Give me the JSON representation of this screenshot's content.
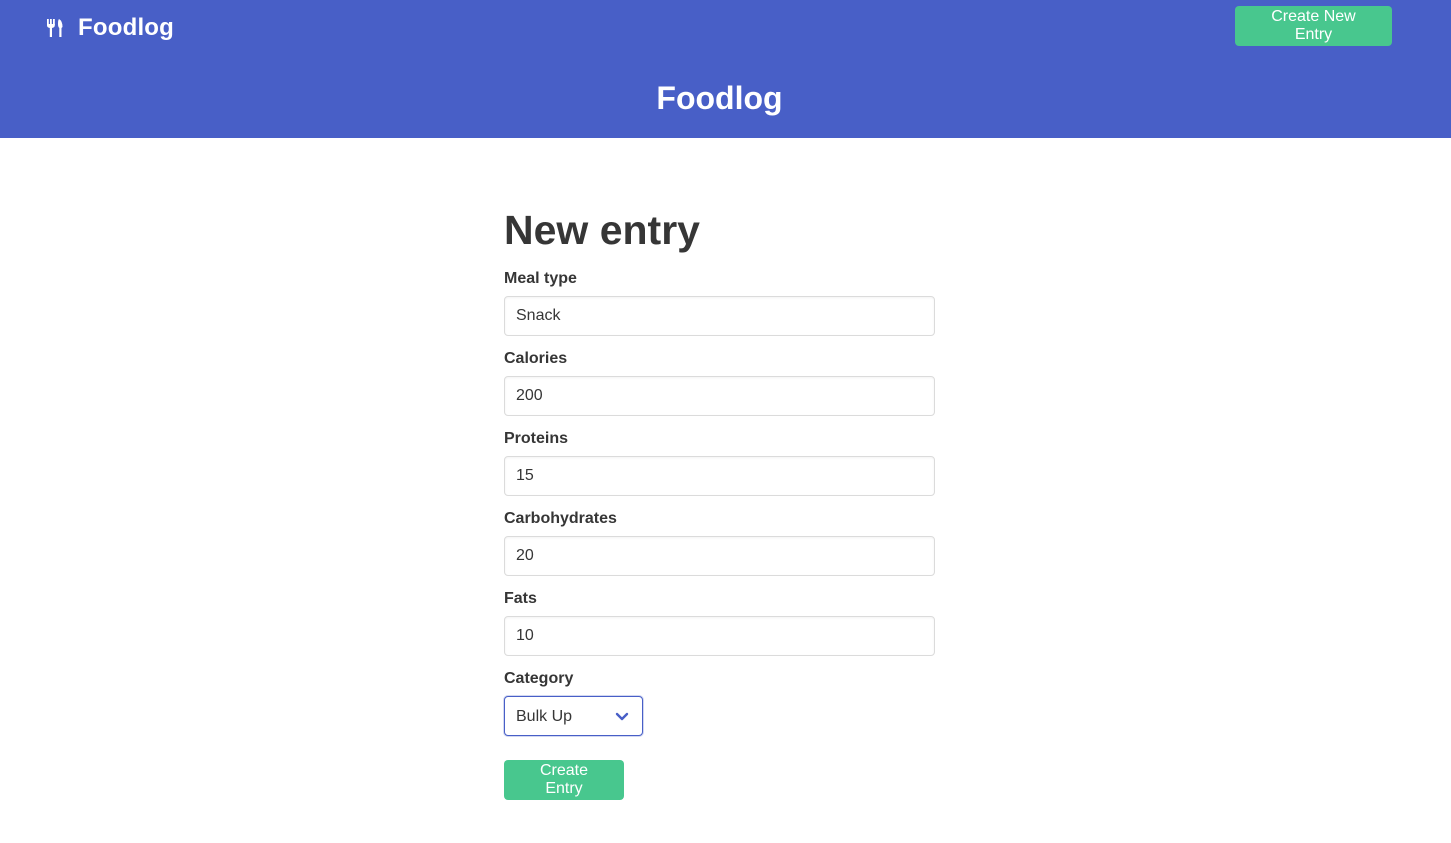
{
  "navbar": {
    "brand": "Foodlog",
    "brand_icon": "utensils-icon",
    "create_button": "Create New Entry"
  },
  "hero": {
    "title": "Foodlog"
  },
  "form": {
    "heading": "New entry",
    "fields": [
      {
        "label": "Meal type",
        "value": "Snack"
      },
      {
        "label": "Calories",
        "value": "200"
      },
      {
        "label": "Proteins",
        "value": "15"
      },
      {
        "label": "Carbohydrates",
        "value": "20"
      },
      {
        "label": "Fats",
        "value": "10"
      }
    ],
    "category": {
      "label": "Category",
      "selected": "Bulk Up",
      "icon": "chevron-down-icon"
    },
    "submit_label": "Create Entry"
  },
  "colors": {
    "primary": "#485fc7",
    "success": "#48c78e",
    "heading": "#363636"
  }
}
